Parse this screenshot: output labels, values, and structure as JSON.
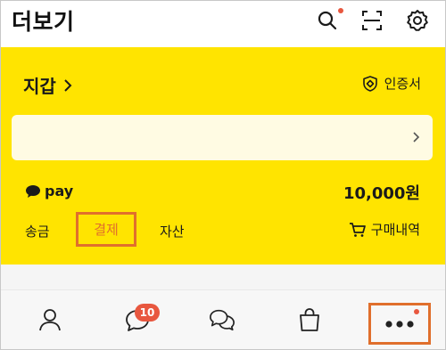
{
  "header": {
    "title": "더보기",
    "icons": [
      "search-icon",
      "scan-icon",
      "settings-icon"
    ]
  },
  "wallet": {
    "title": "지갑",
    "certificate_label": "인증서",
    "pay_label": "pay",
    "balance": "10,000원",
    "tabs": [
      "송금",
      "결제",
      "자산"
    ],
    "highlighted_tab": "결제",
    "purchase_history_label": "구매내역"
  },
  "bottom_nav": {
    "items": [
      "person-icon",
      "chat-icon",
      "open-chat-icon",
      "shopping-bag-icon",
      "more-icon"
    ],
    "chat_badge": "10"
  },
  "colors": {
    "wallet_bg": "#ffe400",
    "highlight": "#e06f2c",
    "notification": "#e8573f",
    "banner_bg": "#fffbe3"
  }
}
